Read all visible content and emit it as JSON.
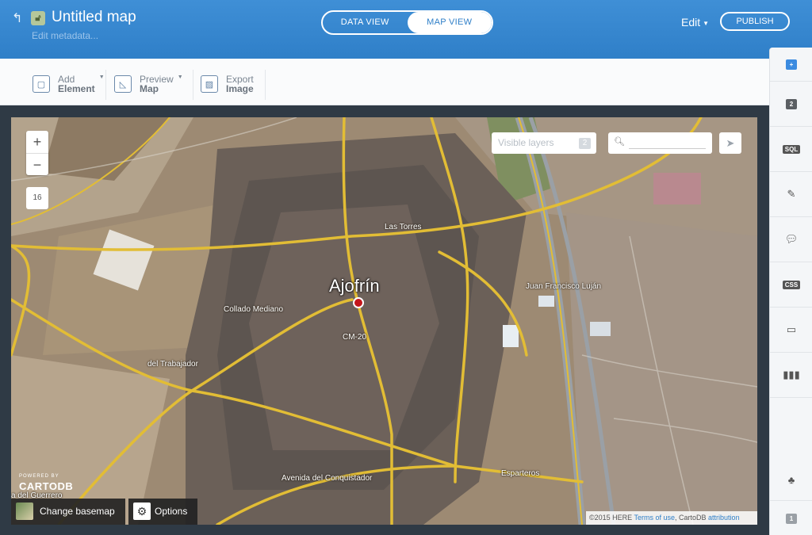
{
  "header": {
    "back_icon": "back-arrow-icon",
    "lock_icon": "lock-icon",
    "title": "Untitled map",
    "edit_metadata": "Edit metadata...",
    "data_view": "DATA VIEW",
    "map_view": "MAP VIEW",
    "edit_label": "Edit",
    "publish": "PUBLISH",
    "accent": "#2f7fc8"
  },
  "toolbar": {
    "add_top": "Add",
    "add_bottom": "Element",
    "preview_top": "Preview",
    "preview_bottom": "Map",
    "export_top": "Export",
    "export_bottom": "Image"
  },
  "map": {
    "zoom_in": "+",
    "zoom_out": "−",
    "zoom_level": "16",
    "visible_layers": "Visible layers",
    "layer_count": "2",
    "city": "Ajofrín",
    "labels": {
      "las_torres": "Las Torres",
      "juan_francisco": "Juan Francisco Luján",
      "collado": "Collado Mediano",
      "cm20": "CM-20",
      "trabajador": "del Trabajador",
      "conquistador": "Avenida del Conquistador",
      "esparteros": "Esparteros",
      "guerrero": "a del Guerrero"
    },
    "powered_by": "POWERED BY",
    "cartodb": "CARTODB",
    "change_basemap": "Change basemap",
    "options": "Options",
    "attribution_prefix": "©2015 HERE ",
    "terms": "Terms of use",
    "attribution_mid": ", CartoDB ",
    "attribution_link": "attribution"
  },
  "sidebar": {
    "layers_top_badge": "2",
    "sql": "SQL",
    "css": "CSS",
    "bottom_badge": "1"
  }
}
